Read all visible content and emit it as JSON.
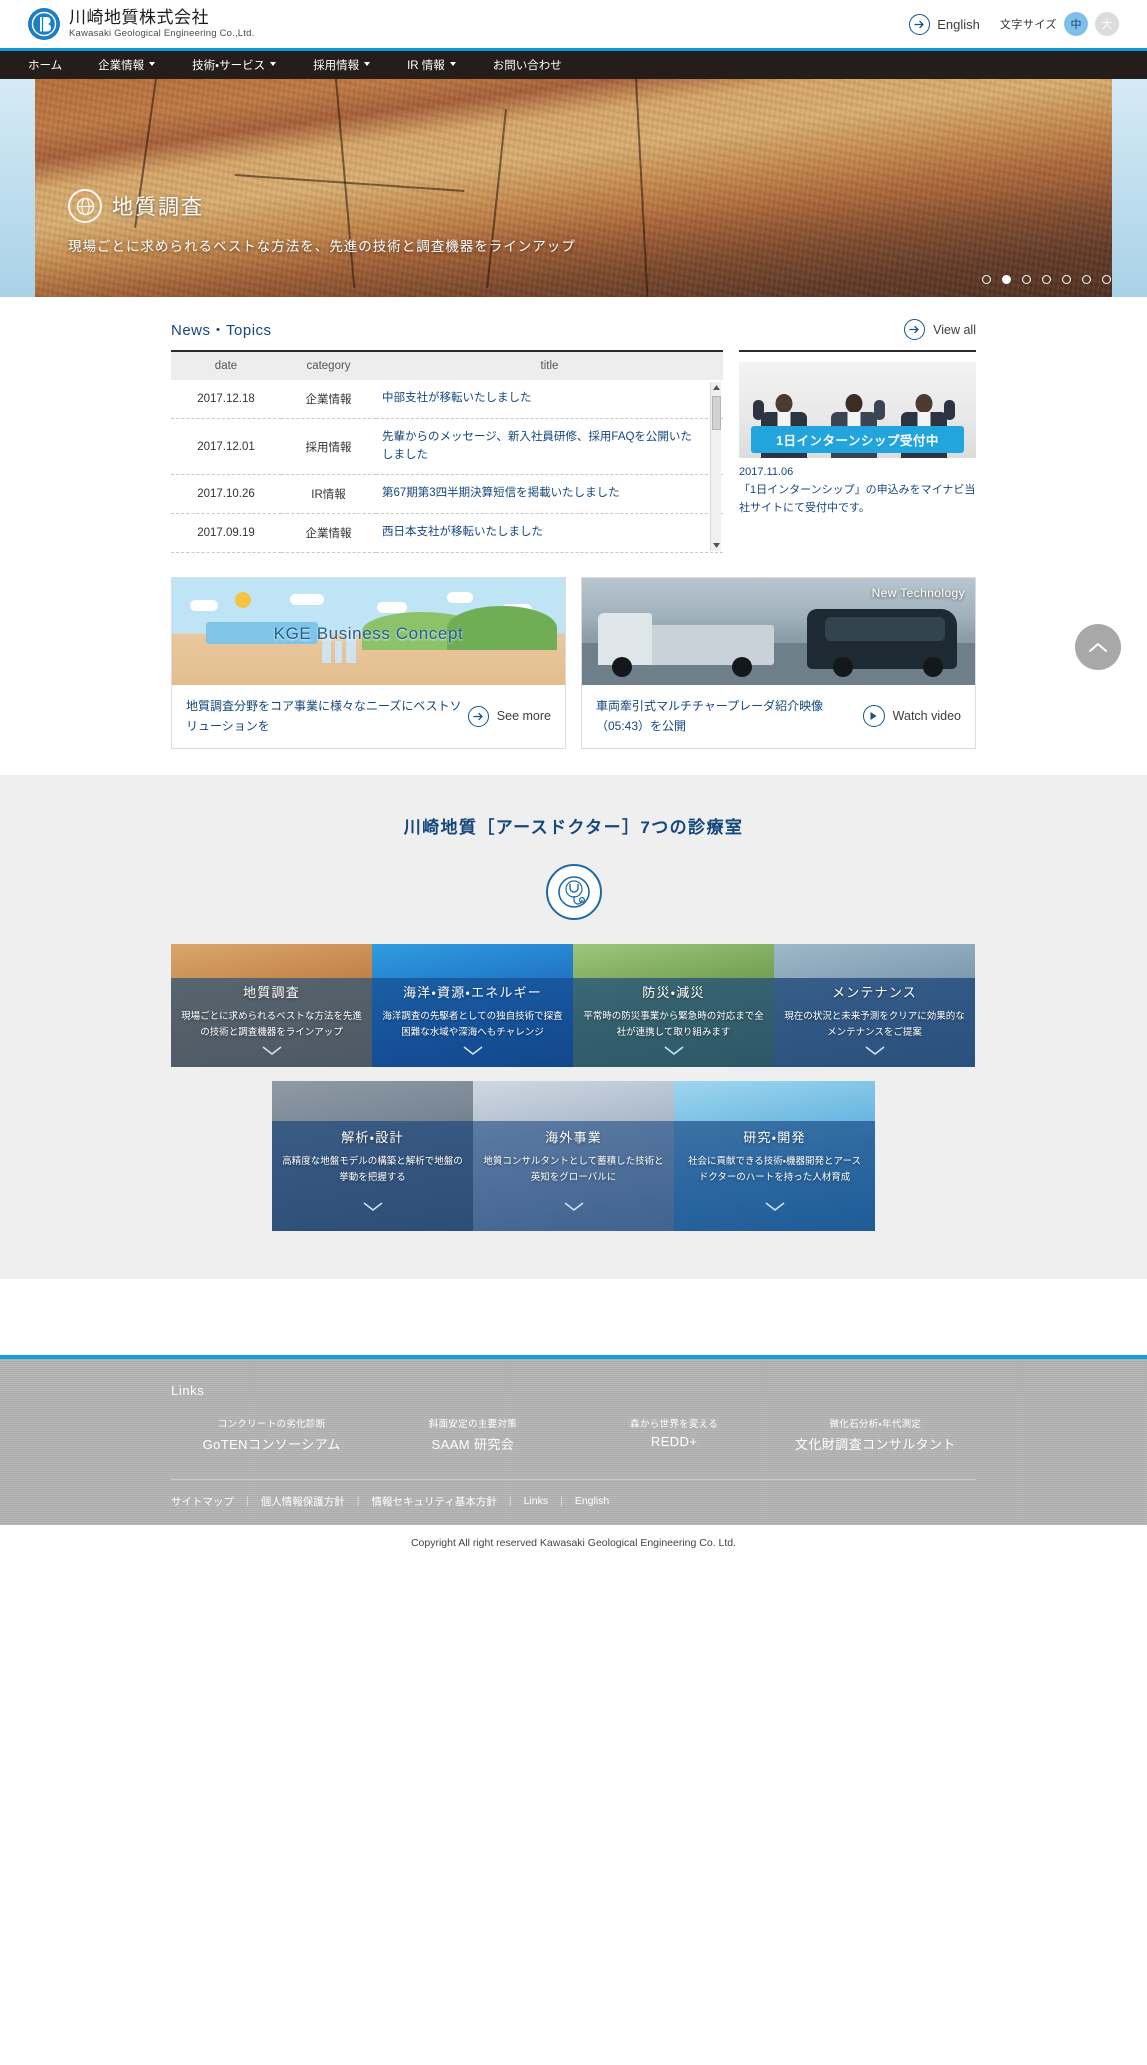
{
  "header": {
    "logo_jp": "川崎地質株式会社",
    "logo_en": "Kawasaki Geological Engineering Co.,Ltd.",
    "english_label": "English",
    "fontsize_label": "文字サイズ",
    "fontsize_medium": "中",
    "fontsize_large": "大"
  },
  "nav": {
    "items": [
      {
        "label": "ホーム",
        "has_chevron": false
      },
      {
        "label": "企業情報",
        "has_chevron": true
      },
      {
        "label": "技術・サービス",
        "has_chevron": true
      },
      {
        "label": "採用情報",
        "has_chevron": true
      },
      {
        "label": "IR 情報",
        "has_chevron": true
      },
      {
        "label": "お問い合わせ",
        "has_chevron": false
      }
    ]
  },
  "hero": {
    "title": "地質調査",
    "subtitle": "現場ごとに求められるベストな方法を、先進の技術と調査機器をラインアップ",
    "slide_count": 7,
    "active_slide": 2
  },
  "news": {
    "title": "News・Topics",
    "view_all": "View all",
    "columns": [
      "date",
      "category",
      "title"
    ],
    "rows": [
      {
        "date": "2017.12.18",
        "category": "企業情報",
        "title": "中部支社が移転いたしました"
      },
      {
        "date": "2017.12.01",
        "category": "採用情報",
        "title": "先輩からのメッセージ、新入社員研修、採用FAQを公開いたしました"
      },
      {
        "date": "2017.10.26",
        "category": "IR情報",
        "title": "第67期第3四半期決算短信を掲載いたしました"
      },
      {
        "date": "2017.09.19",
        "category": "企業情報",
        "title": "西日本支社が移転いたしました"
      }
    ]
  },
  "aside": {
    "badge": "1日インターンシップ受付中",
    "date": "2017.11.06",
    "text": "「1日インターンシップ」の申込みをマイナビ当社サイトにて受付中です。"
  },
  "cards": [
    {
      "image_label": "KGE Business Concept",
      "text": "地質調査分野をコア事業に様々なニーズにベストソリューションを",
      "cta": "See more",
      "cta_icon": "arrow-right-icon"
    },
    {
      "image_label": "New Technology",
      "text": "車両牽引式マルチチャープレーダ紹介映像（05:43）を公開",
      "cta": "Watch video",
      "cta_icon": "play-icon"
    }
  ],
  "doctor": {
    "title": "川崎地質［アースドクター］7つの診療室",
    "row1": [
      {
        "title": "地質調査",
        "desc": "現場ごとに求められるベストな方法を先進の技術と調査機器をラインアップ"
      },
      {
        "title": "海洋・資源・エネルギー",
        "desc": "海洋調査の先駆者としての独自技術で探査困難な水域や深海へもチャレンジ"
      },
      {
        "title": "防災・減災",
        "desc": "平常時の防災事業から緊急時の対応まで全社が連携して取り組みます"
      },
      {
        "title": "メンテナンス",
        "desc": "現在の状況と未来予測をクリアに効果的なメンテナンスをご提案"
      }
    ],
    "row2": [
      {
        "title": "解析・設計",
        "desc": "高精度な地盤モデルの構築と解析で地盤の挙動を把握する"
      },
      {
        "title": "海外事業",
        "desc": "地質コンサルタントとして蓄積した技術と英知をグローバルに"
      },
      {
        "title": "研究・開発",
        "desc": "社会に貢献できる技術・機器開発とアースドクターのハートを持った人材育成"
      }
    ]
  },
  "footer": {
    "links_title": "Links",
    "link_items": [
      {
        "small": "コンクリートの劣化診断",
        "big": "GoTENコンソーシアム"
      },
      {
        "small": "斜面安定の主要対策",
        "big": "SAAM 研究会"
      },
      {
        "small": "森から世界を変える",
        "big": "REDD+"
      },
      {
        "small": "微化石分析・年代測定",
        "big": "文化財調査コンサルタント"
      }
    ],
    "nav_items": [
      "サイトマップ",
      "個人情報保護方針",
      "情報セキュリティ基本方針",
      "Links",
      "English"
    ],
    "copyright": "Copyright All right reserved Kawasaki Geological Engineering Co. Ltd."
  },
  "colors": {
    "brand_blue": "#0e9ad8",
    "nav_dark": "#241d1a",
    "heading_blue": "#15477d",
    "footer_gray": "#b3b3b3"
  }
}
